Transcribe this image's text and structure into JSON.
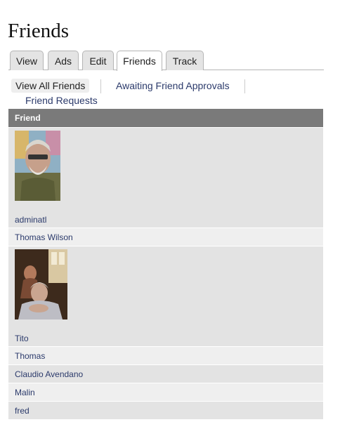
{
  "page": {
    "title": "Friends"
  },
  "tabs": [
    {
      "label": "View"
    },
    {
      "label": "Ads"
    },
    {
      "label": "Edit"
    },
    {
      "label": "Friends",
      "active": true
    },
    {
      "label": "Track"
    }
  ],
  "subtabs": [
    {
      "label": "View All Friends",
      "active": true
    },
    {
      "label": "Awaiting Friend Approvals"
    },
    {
      "label": "Friend Requests"
    }
  ],
  "table": {
    "header": "Friend",
    "rows": [
      {
        "name": "adminatl",
        "has_photo": true
      },
      {
        "name": "Thomas Wilson"
      },
      {
        "name": "Tito",
        "has_photo": true
      },
      {
        "name": "Thomas"
      },
      {
        "name": "Claudio Avendano"
      },
      {
        "name": "Malin"
      },
      {
        "name": "fred"
      }
    ]
  },
  "colors": {
    "header_bg": "#7a7a7a",
    "row_odd": "#e3e3e3",
    "row_even": "#efefef",
    "link": "#2b3a6b"
  }
}
